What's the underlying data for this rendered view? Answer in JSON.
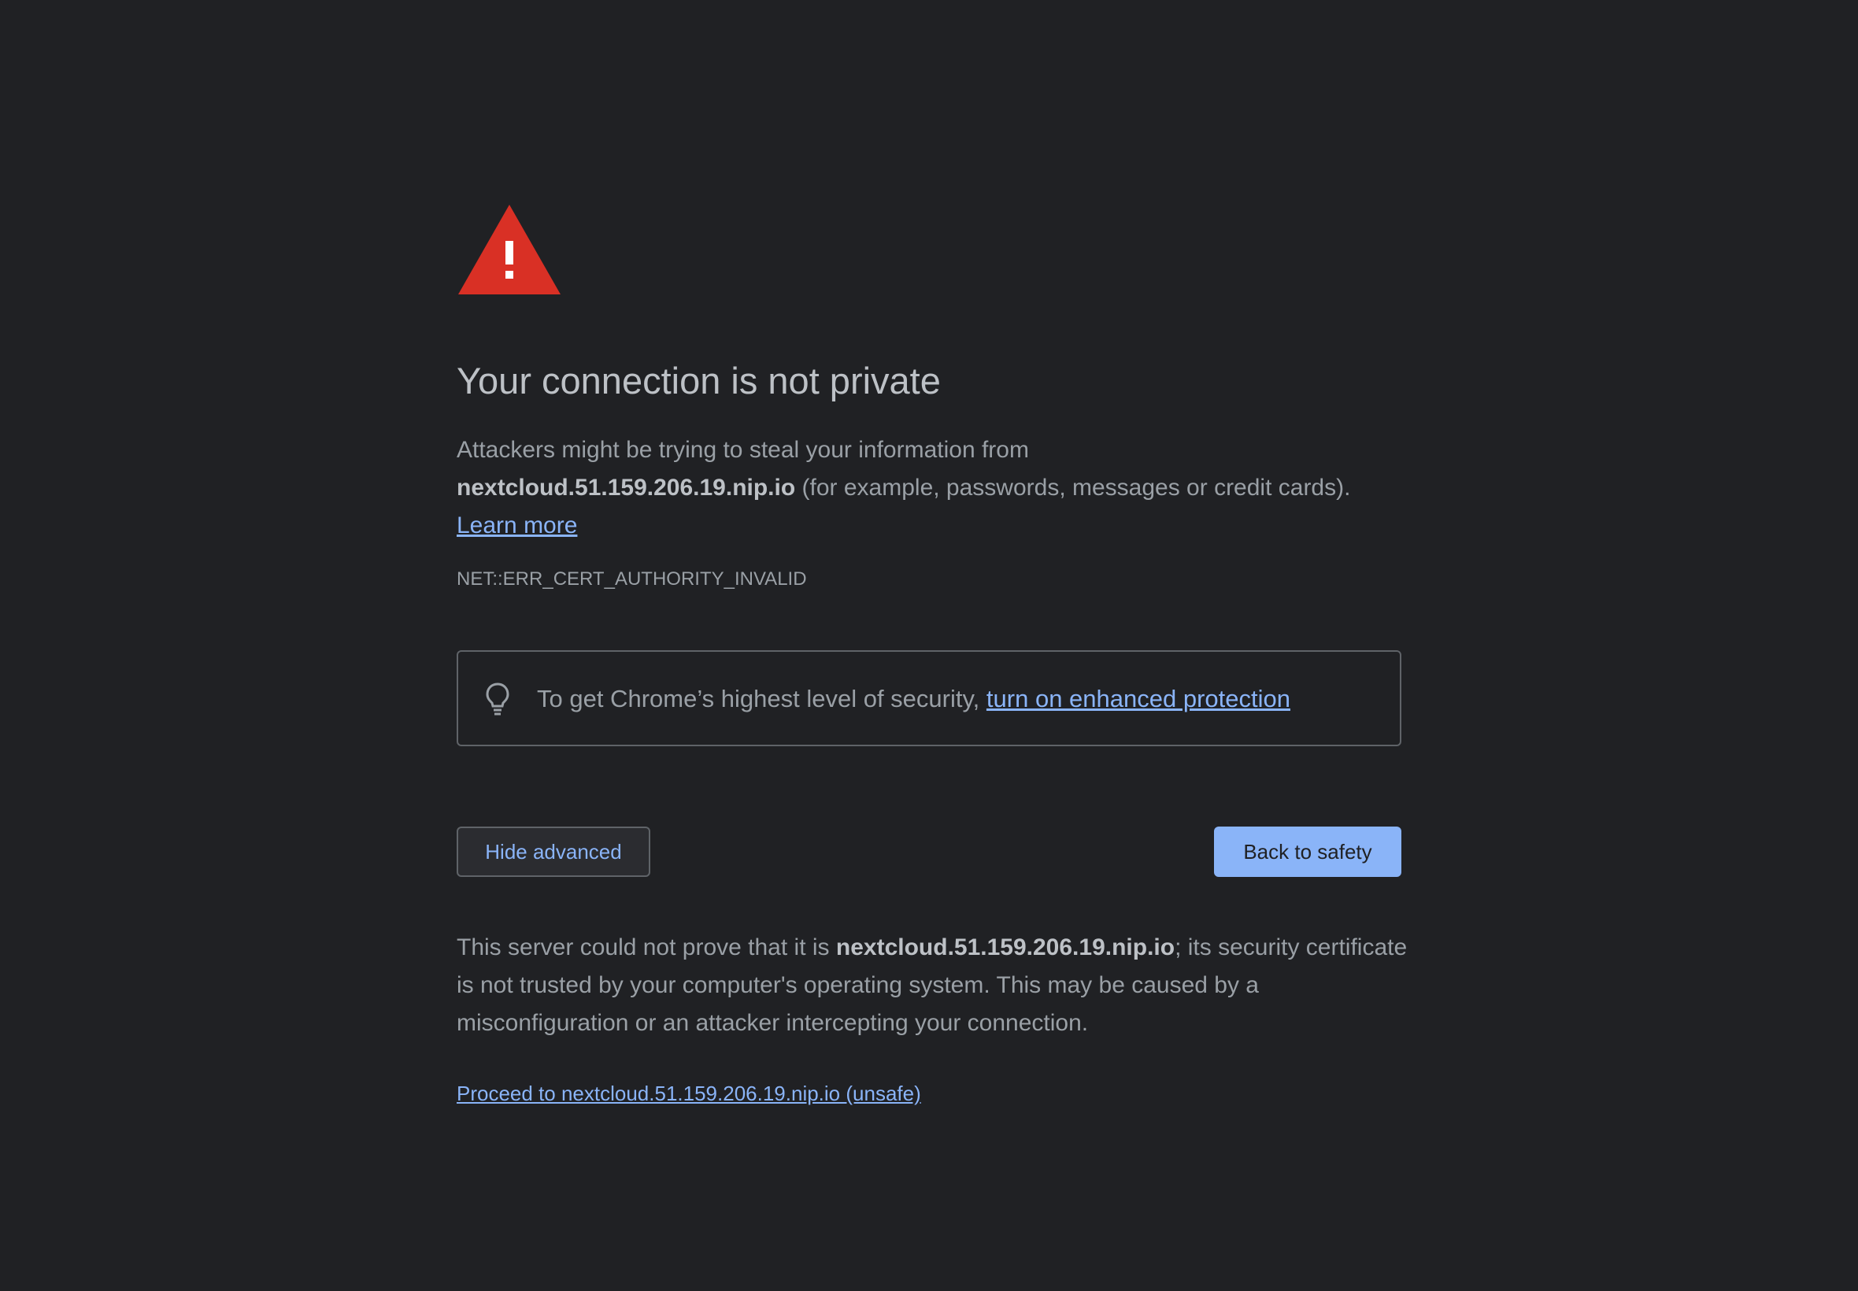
{
  "page": {
    "icon": "warning-triangle-icon",
    "title": "Your connection is not private",
    "intro": {
      "text_before": "Attackers might be trying to steal your information from",
      "domain": "nextcloud.51.159.206.19.nip.io",
      "text_after": "(for example, passwords, messages or credit cards).",
      "learn_more": "Learn more"
    },
    "error_code": "NET::ERR_CERT_AUTHORITY_INVALID",
    "tip": {
      "icon": "lightbulb-icon",
      "text": "To get Chrome’s highest level of security,",
      "link": "turn on enhanced protection"
    },
    "buttons": {
      "hide_advanced": "Hide advanced",
      "back_to_safety": "Back to safety"
    },
    "details": {
      "text_before": "This server could not prove that it is",
      "domain": "nextcloud.51.159.206.19.nip.io",
      "text_after": "; its security certificate is not trusted by your computer's operating system. This may be caused by a misconfiguration or an attacker intercepting your connection."
    },
    "proceed_link": "Proceed to nextcloud.51.159.206.19.nip.io (unsafe)"
  },
  "colors": {
    "background": "#202124",
    "warning_red": "#d93025",
    "link_blue": "#8ab4f8"
  }
}
